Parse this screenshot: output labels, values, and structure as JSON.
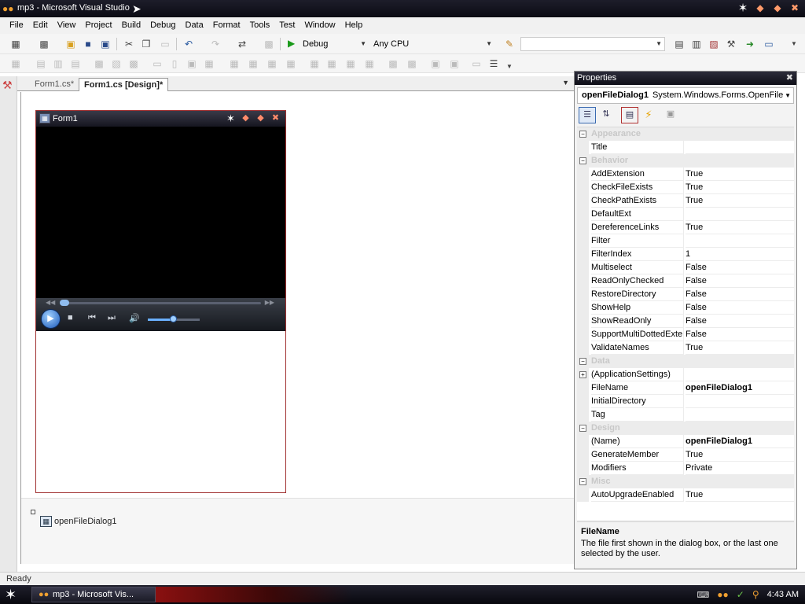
{
  "window": {
    "title": "mp3 - Microsoft Visual Studio"
  },
  "menu": [
    "File",
    "Edit",
    "View",
    "Project",
    "Build",
    "Debug",
    "Data",
    "Format",
    "Tools",
    "Test",
    "Window",
    "Help"
  ],
  "toolbar": {
    "config_combo": "Debug",
    "platform_combo": "Any CPU"
  },
  "tabs": [
    {
      "label": "Form1.cs*",
      "active": false
    },
    {
      "label": "Form1.cs [Design]*",
      "active": true
    }
  ],
  "form": {
    "title": "Form1"
  },
  "tray": {
    "component_label": "openFileDialog1"
  },
  "properties": {
    "title": "Properties",
    "object_name": "openFileDialog1",
    "object_type": "System.Windows.Forms.OpenFile",
    "rows": [
      {
        "kind": "category",
        "name": "Appearance"
      },
      {
        "kind": "prop",
        "name": "Title",
        "value": ""
      },
      {
        "kind": "category",
        "name": "Behavior"
      },
      {
        "kind": "prop",
        "name": "AddExtension",
        "value": "True"
      },
      {
        "kind": "prop",
        "name": "CheckFileExists",
        "value": "True"
      },
      {
        "kind": "prop",
        "name": "CheckPathExists",
        "value": "True"
      },
      {
        "kind": "prop",
        "name": "DefaultExt",
        "value": ""
      },
      {
        "kind": "prop",
        "name": "DereferenceLinks",
        "value": "True"
      },
      {
        "kind": "prop",
        "name": "Filter",
        "value": ""
      },
      {
        "kind": "prop",
        "name": "FilterIndex",
        "value": "1"
      },
      {
        "kind": "prop",
        "name": "Multiselect",
        "value": "False"
      },
      {
        "kind": "prop",
        "name": "ReadOnlyChecked",
        "value": "False"
      },
      {
        "kind": "prop",
        "name": "RestoreDirectory",
        "value": "False"
      },
      {
        "kind": "prop",
        "name": "ShowHelp",
        "value": "False"
      },
      {
        "kind": "prop",
        "name": "ShowReadOnly",
        "value": "False"
      },
      {
        "kind": "prop",
        "name": "SupportMultiDottedExte",
        "value": "False"
      },
      {
        "kind": "prop",
        "name": "ValidateNames",
        "value": "True"
      },
      {
        "kind": "category",
        "name": "Data"
      },
      {
        "kind": "prop",
        "name": "(ApplicationSettings)",
        "value": "",
        "expandable": true
      },
      {
        "kind": "prop",
        "name": "FileName",
        "value": "openFileDialog1",
        "bold": true
      },
      {
        "kind": "prop",
        "name": "InitialDirectory",
        "value": ""
      },
      {
        "kind": "prop",
        "name": "Tag",
        "value": ""
      },
      {
        "kind": "category",
        "name": "Design"
      },
      {
        "kind": "prop",
        "name": "(Name)",
        "value": "openFileDialog1",
        "bold": true
      },
      {
        "kind": "prop",
        "name": "GenerateMember",
        "value": "True"
      },
      {
        "kind": "prop",
        "name": "Modifiers",
        "value": "Private"
      },
      {
        "kind": "category",
        "name": "Misc"
      },
      {
        "kind": "prop",
        "name": "AutoUpgradeEnabled",
        "value": "True"
      }
    ],
    "description_title": "FileName",
    "description_text": "The file first shown in the dialog box, or the last one selected by the user."
  },
  "status": "Ready",
  "taskbar": {
    "task_label": "mp3 - Microsoft Vis...",
    "clock": "4:43 AM"
  }
}
